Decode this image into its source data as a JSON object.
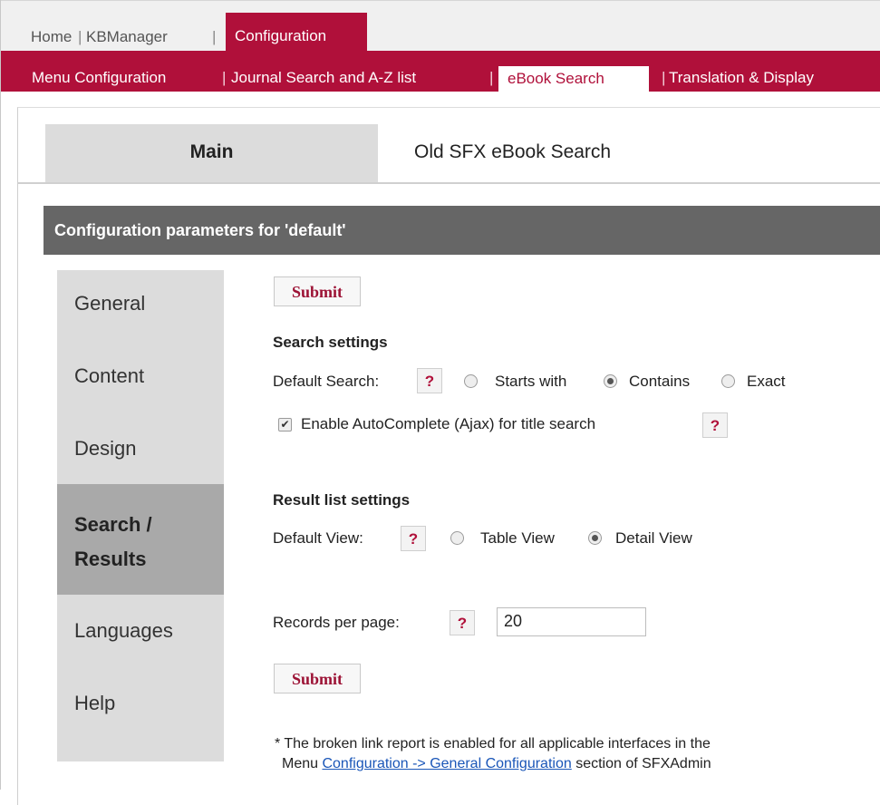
{
  "topnav": {
    "home": "Home",
    "kbmanager": "KBManager",
    "sep": "|",
    "configuration": "Configuration"
  },
  "subnav": {
    "menu_configuration": "Menu Configuration",
    "journal_search": "Journal Search and A-Z list",
    "ebook_search": "eBook Search",
    "translation_display": "Translation & Display",
    "sep": "|"
  },
  "tabs": {
    "main": "Main",
    "old": "Old SFX eBook Search"
  },
  "config_header": "Configuration parameters for 'default'",
  "sidebar": {
    "items": [
      {
        "label": "General"
      },
      {
        "label": "Content"
      },
      {
        "label": "Design"
      },
      {
        "label_line1": "Search /",
        "label_line2": "Results"
      },
      {
        "label": "Languages"
      },
      {
        "label": "Help"
      }
    ]
  },
  "content": {
    "submit_label": "Submit",
    "help_glyph": "?",
    "search_settings": {
      "title": "Search settings",
      "default_search_label": "Default Search:",
      "options": [
        "Starts with",
        "Contains",
        "Exact"
      ],
      "selected": "Contains",
      "autocomplete_label": "Enable AutoComplete (Ajax) for title search",
      "autocomplete_checked": true,
      "checkmark": "✔"
    },
    "result_settings": {
      "title": "Result list settings",
      "default_view_label": "Default View:",
      "options": [
        "Table View",
        "Detail View"
      ],
      "selected": "Detail View"
    },
    "records_label": "Records per page:",
    "records_value": "20",
    "note_line1": "* The broken link report is enabled for all applicable interfaces in the",
    "note_line2_prefix": "Menu ",
    "note_link": "Configuration -> General Configuration",
    "note_line2_suffix": " section of SFXAdmin"
  },
  "colors": {
    "brand": "#b0103a",
    "header_bg": "#666666",
    "nav_bg": "#dcdcdc",
    "nav_active_bg": "#a9a9a9"
  }
}
